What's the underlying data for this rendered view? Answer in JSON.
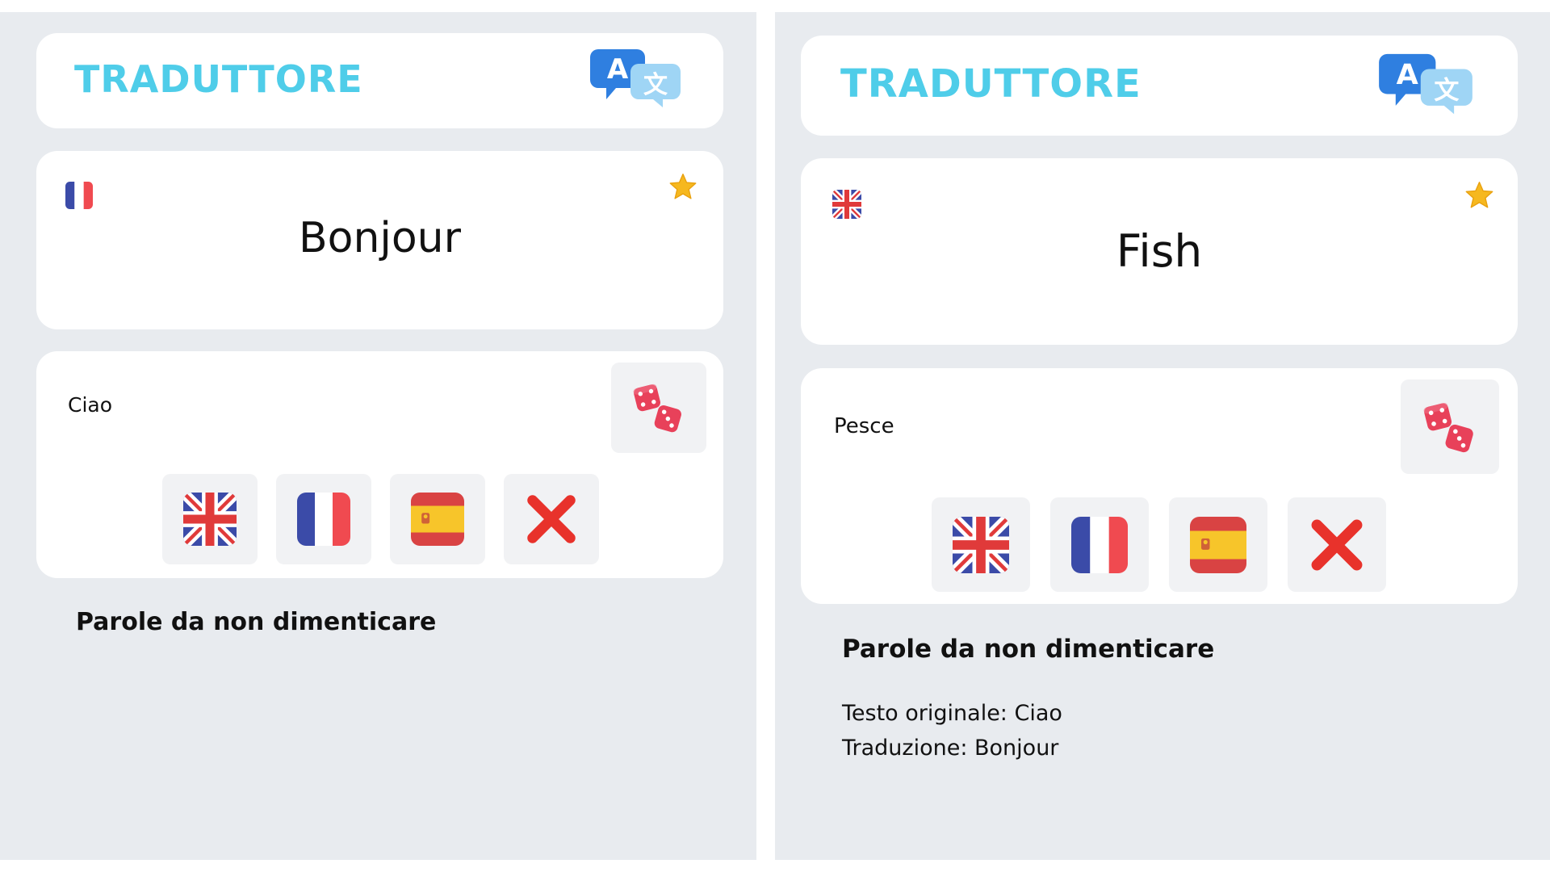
{
  "colors": {
    "background": "#e8ebef",
    "card": "#ffffff",
    "title_accent": "#4fcde9",
    "button_bg": "#f1f2f4",
    "close_red": "#e8322b"
  },
  "icons": {
    "logo": "translate-bubbles-icon",
    "favorite": "star-icon",
    "random": "dice-icon",
    "english": "uk-flag-icon",
    "french": "france-flag-icon",
    "spanish": "spain-flag-icon",
    "clear": "close-icon"
  },
  "screens": [
    {
      "header_title": "TRADUTTORE",
      "translation": {
        "language_flag": "france-flag-icon",
        "word": "Bonjour"
      },
      "input": {
        "text": "Ciao"
      },
      "saved": {
        "title": "Parole da non dimenticare",
        "entries": []
      }
    },
    {
      "header_title": "TRADUTTORE",
      "translation": {
        "language_flag": "uk-flag-icon",
        "word": "Fish"
      },
      "input": {
        "text": "Pesce"
      },
      "saved": {
        "title": "Parole da non dimenticare",
        "entries": [
          {
            "original": "Testo originale: Ciao",
            "translation": "Traduzione: Bonjour"
          }
        ]
      }
    }
  ]
}
